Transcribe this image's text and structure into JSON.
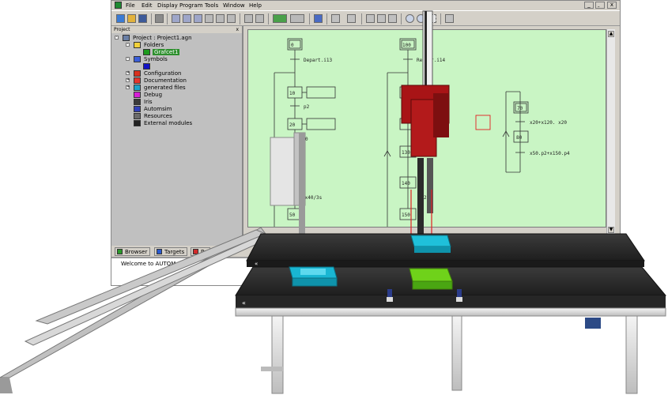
{
  "menu": {
    "items": [
      "File",
      "Edit",
      "Display",
      "Program",
      "Tools",
      "Window",
      "Help"
    ]
  },
  "window_controls": {
    "minimize": "_",
    "restore": "̱",
    "close": "x"
  },
  "project_panel": {
    "title": "Project",
    "close": "x",
    "tree": [
      {
        "label": "Project : Project1.agn"
      },
      {
        "label": "Folders"
      },
      {
        "label": "Grafcet1"
      },
      {
        "label": "Symbols"
      },
      {
        "label": "Configuration"
      },
      {
        "label": "Documentation"
      },
      {
        "label": "generated files"
      },
      {
        "label": "Debug"
      },
      {
        "label": "Iris"
      },
      {
        "label": "Automsim"
      },
      {
        "label": "Resources"
      },
      {
        "label": "External modules"
      }
    ]
  },
  "tabs": [
    "Browser",
    "Targets",
    "Pa"
  ],
  "messages": {
    "text": "Welcome to AUTOM"
  },
  "grafcet": {
    "left": {
      "steps": [
        "0",
        "10",
        "20",
        "50"
      ],
      "transitions": [
        "Depart.i13",
        "p2",
        "0",
        "/x40/3s"
      ]
    },
    "middle": {
      "steps": [
        "100",
        "130",
        "140",
        "150"
      ],
      "transitions": [
        "Retour.i14",
        "2s"
      ]
    },
    "right": {
      "steps": [
        "70",
        "80"
      ],
      "transitions": [
        "x20+x120. x20",
        "x50.p2+x150.p4"
      ]
    }
  },
  "colors": {
    "canvas_bg": "#c9f5c4",
    "app_chrome": "#d4d0c8",
    "robot_red": "#a81416",
    "belt": "#2d2d2d",
    "frame": "#e3e3e3",
    "part_cyan": "#19b6d2",
    "part_green": "#6fd21a"
  },
  "icons": [
    "app-icon",
    "new-file-icon",
    "open-folder-icon",
    "save-icon",
    "print-icon",
    "zoom-in-icon",
    "zoom-out-icon",
    "run-icon"
  ]
}
